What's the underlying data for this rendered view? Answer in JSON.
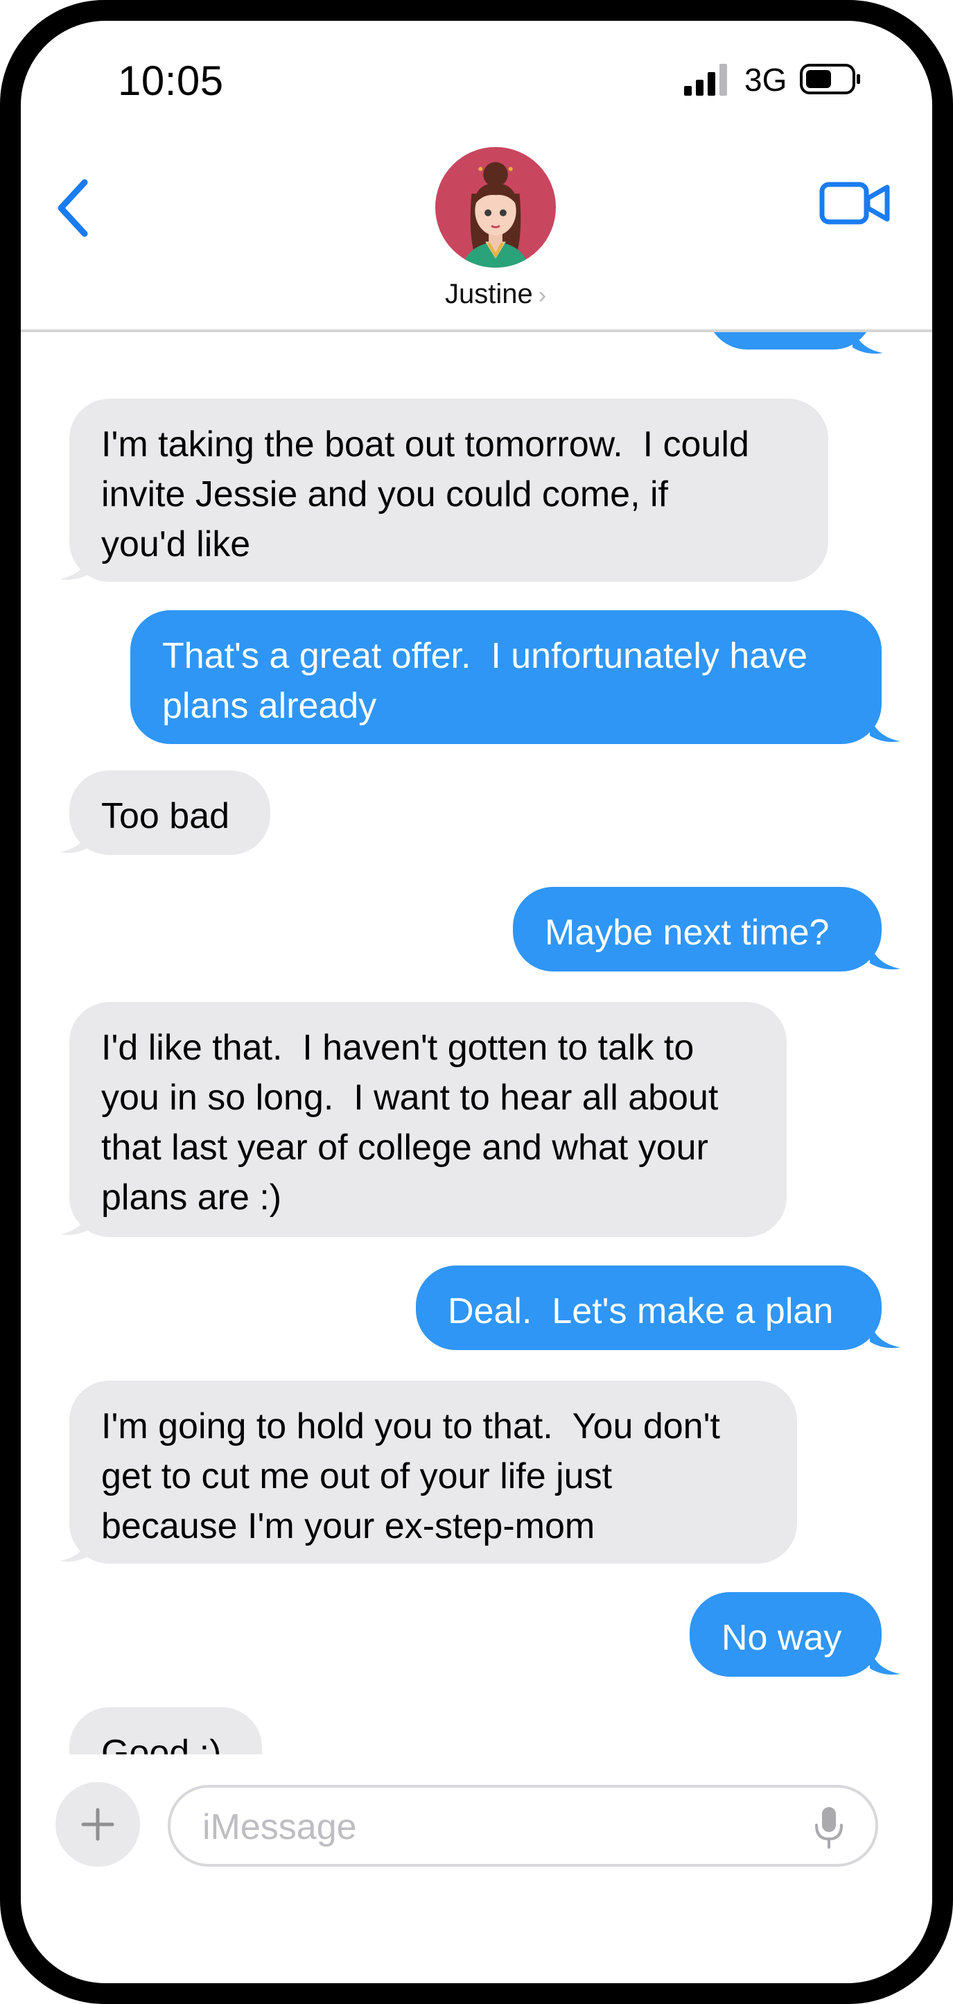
{
  "status_bar": {
    "time": "10:05",
    "network": "3G",
    "signal_icon": "signal-bars-icon",
    "battery_icon": "battery-icon"
  },
  "header": {
    "contact_name": "Justine",
    "back_icon": "chevron-left-icon",
    "video_icon": "video-camera-icon",
    "accent_color": "#1a7cf0"
  },
  "messages": [
    {
      "direction": "outgoing",
      "text": ""
    },
    {
      "direction": "incoming",
      "text": "I'm taking the boat out tomorrow.  I could\ninvite Jessie and you could come, if\nyou'd like"
    },
    {
      "direction": "outgoing",
      "text": "That's a great offer.  I unfortunately have\nplans already"
    },
    {
      "direction": "incoming",
      "text": "Too bad"
    },
    {
      "direction": "outgoing",
      "text": "Maybe next time?"
    },
    {
      "direction": "incoming",
      "text": "I'd like that.  I haven't gotten to talk to\nyou in so long.  I want to hear all about\nthat last year of college and what your\nplans are :)"
    },
    {
      "direction": "outgoing",
      "text": "Deal.  Let's make a plan"
    },
    {
      "direction": "incoming",
      "text": "I'm going to hold you to that.  You don't\nget to cut me out of your life just\nbecause I'm your ex-step-mom"
    },
    {
      "direction": "outgoing",
      "text": "No way"
    },
    {
      "direction": "incoming",
      "text": "Good :)"
    }
  ],
  "composer": {
    "placeholder": "iMessage",
    "value": "",
    "plus_icon": "plus-icon",
    "mic_icon": "microphone-icon"
  },
  "colors": {
    "incoming_bubble": "#e9e9eb",
    "outgoing_bubble": "#2f96f5"
  }
}
